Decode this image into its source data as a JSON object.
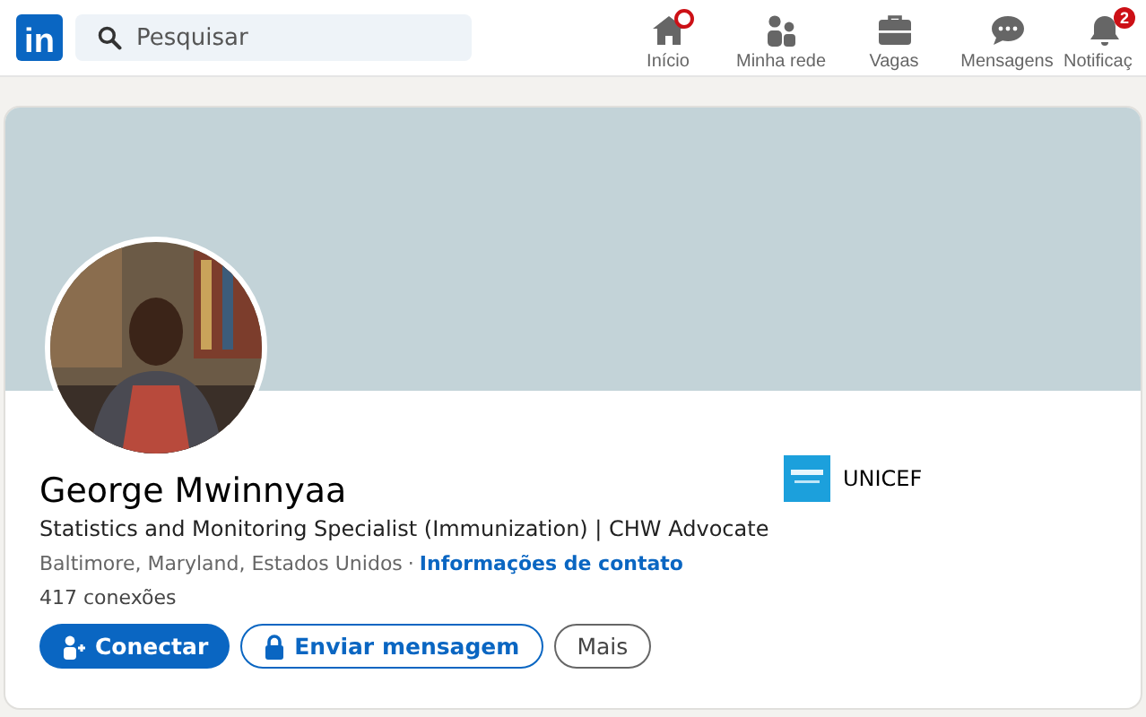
{
  "header": {
    "logo": "in",
    "search": {
      "placeholder": "Pesquisar"
    },
    "nav": [
      {
        "kind": "home",
        "label": "Início",
        "selected": false,
        "dot": true
      },
      {
        "kind": "network",
        "label": "Minha rede",
        "selected": false
      },
      {
        "kind": "jobs",
        "label": "Vagas",
        "selected": false
      },
      {
        "kind": "messages",
        "label": "Mensagens",
        "selected": false
      },
      {
        "kind": "bell",
        "label": "Notificaç",
        "selected": false,
        "badge": "2"
      }
    ]
  },
  "profile": {
    "name": "George Mwinnyaa",
    "headline": "Statistics and Monitoring Specialist (Immunization) | CHW Advocate",
    "location": "Baltimore, Maryland, Estados Unidos",
    "separator": "·",
    "contact_link": "Informações de contato",
    "connections": "417 conexões",
    "organization": "UNICEF",
    "buttons": [
      {
        "kind": "primary",
        "label": "Conectar"
      },
      {
        "kind": "outline",
        "label": "Enviar mensagem"
      },
      {
        "kind": "secondary",
        "label": "Mais"
      }
    ]
  }
}
